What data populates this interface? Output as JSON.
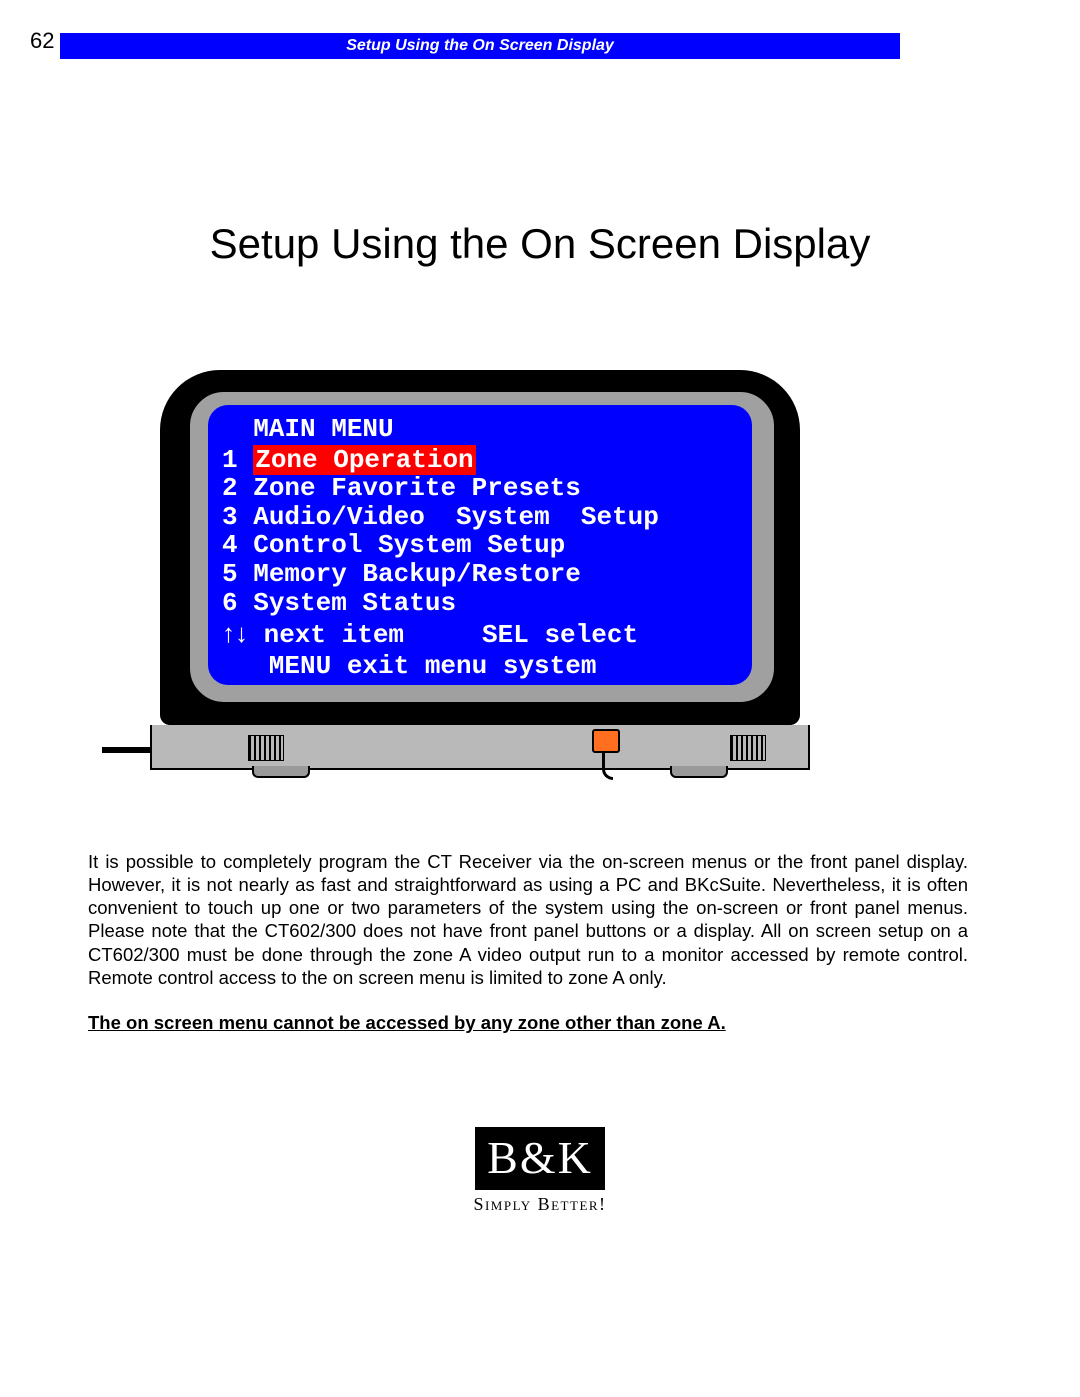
{
  "page_number": "62",
  "header": "Setup Using the On Screen Display",
  "title": "Setup Using the On Screen Display",
  "osd": {
    "header": "  MAIN MENU",
    "items": [
      {
        "num": "1",
        "label": "Zone Operation",
        "selected": true
      },
      {
        "num": "2",
        "label": "Zone Favorite Presets",
        "selected": false
      },
      {
        "num": "3",
        "label": "Audio/Video  System  Setup",
        "selected": false
      },
      {
        "num": "4",
        "label": "Control System Setup",
        "selected": false
      },
      {
        "num": "5",
        "label": "Memory Backup/Restore",
        "selected": false
      },
      {
        "num": "6",
        "label": "System Status",
        "selected": false
      }
    ],
    "nav1_arrows": "↑↓",
    "nav1_rest": " next item     SEL select",
    "nav2": "   MENU exit menu system"
  },
  "body": "It is possible to completely program the CT Receiver via the on-screen menus or the front panel display. However, it is not nearly as fast and straightforward as using a PC and BKcSuite. Nevertheless, it is often convenient to touch up one or two parameters of the system using the on-screen or front panel menus.  Please note that the CT602/300 does not have front panel buttons or a display.  All on screen setup on a CT602/300 must be done through the zone A video output run to a monitor accessed by remote control.  Remote control access to the on screen menu is limited to zone A only.",
  "note": "The on screen menu cannot be accessed by any zone other than zone A.",
  "logo": {
    "mark": "B&K",
    "tagline": "Simply Better!"
  }
}
